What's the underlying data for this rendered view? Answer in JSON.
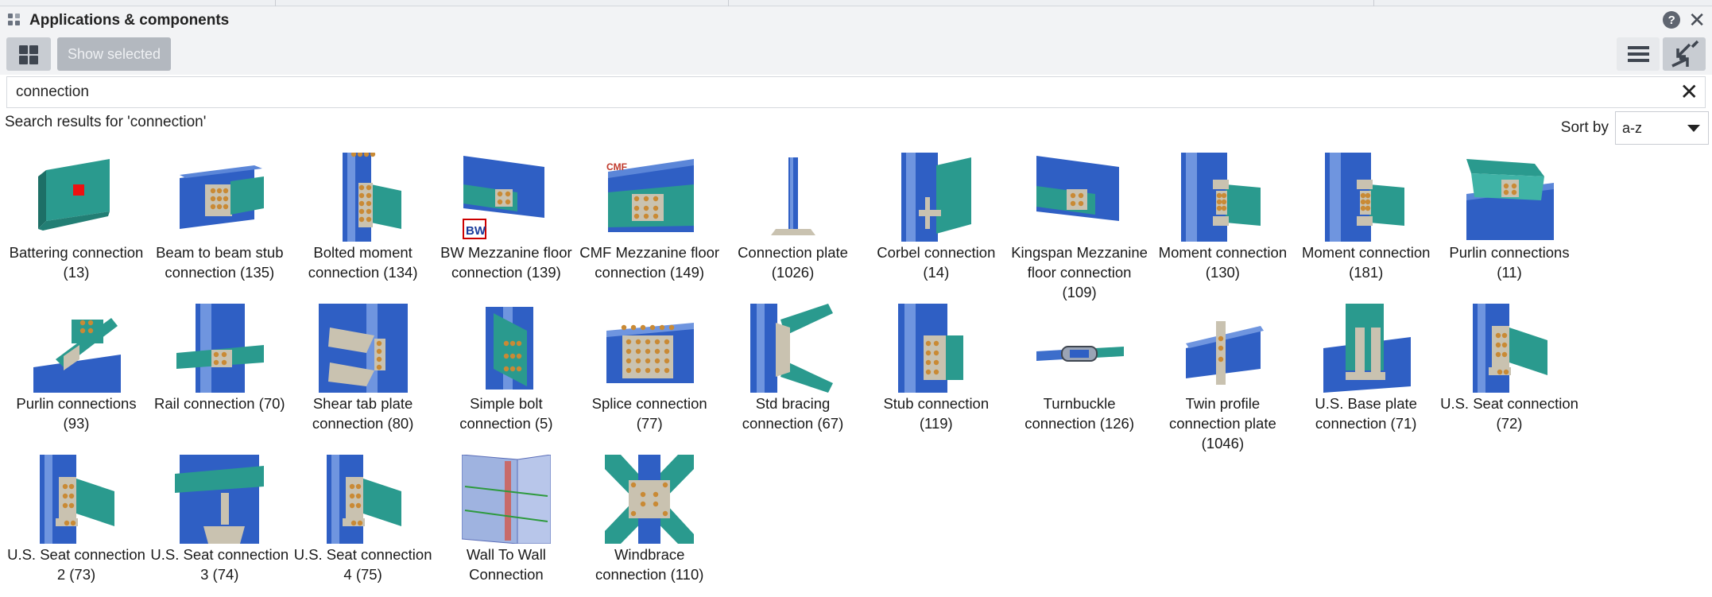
{
  "window": {
    "title": "Applications & components"
  },
  "toolbar": {
    "show_selected_label": "Show selected"
  },
  "search": {
    "value": "connection",
    "placeholder": ""
  },
  "results": {
    "heading": "Search results for 'connection'"
  },
  "sort": {
    "label": "Sort by",
    "selected": "a-z"
  },
  "colors": {
    "steel_blue": "#2f5fc4",
    "teal": "#2a9a8e",
    "plate": "#c9c2b0",
    "bolt": "#c98a35"
  },
  "components": [
    {
      "line1": "Battering connection",
      "line2": "(13)",
      "line3": "",
      "icon": "battering-icon"
    },
    {
      "line1": "Beam to beam stub",
      "line2": "connection (135)",
      "line3": "",
      "icon": "beam-stub-icon"
    },
    {
      "line1": "Bolted moment",
      "line2": "connection (134)",
      "line3": "",
      "icon": "bolted-moment-icon"
    },
    {
      "line1": "BW Mezzanine floor",
      "line2": "connection (139)",
      "line3": "",
      "icon": "bw-mezzanine-icon",
      "badge": "BW"
    },
    {
      "line1": "CMF Mezzanine floor",
      "line2": "connection (149)",
      "line3": "",
      "icon": "cmf-mezzanine-icon",
      "badge": "CMF"
    },
    {
      "line1": "Connection plate",
      "line2": "(1026)",
      "line3": "",
      "icon": "connection-plate-icon"
    },
    {
      "line1": "Corbel connection",
      "line2": "(14)",
      "line3": "",
      "icon": "corbel-icon"
    },
    {
      "line1": "Kingspan Mezzanine",
      "line2": "floor connection",
      "line3": "(109)",
      "icon": "kingspan-icon"
    },
    {
      "line1": "Moment connection",
      "line2": "(130)",
      "line3": "",
      "icon": "moment-icon"
    },
    {
      "line1": "Moment connection",
      "line2": "(181)",
      "line3": "",
      "icon": "moment-icon"
    },
    {
      "line1": "Purlin connections",
      "line2": "(11)",
      "line3": "",
      "icon": "purlin-icon"
    },
    {
      "line1": "Purlin connections",
      "line2": "(93)",
      "line3": "",
      "icon": "purlin-cleat-icon"
    },
    {
      "line1": "Rail connection (70)",
      "line2": "",
      "line3": "",
      "icon": "rail-icon"
    },
    {
      "line1": "Shear tab plate",
      "line2": "connection (80)",
      "line3": "",
      "icon": "shear-tab-icon"
    },
    {
      "line1": "Simple bolt",
      "line2": "connection (5)",
      "line3": "",
      "icon": "simple-bolt-icon"
    },
    {
      "line1": "Splice connection",
      "line2": "(77)",
      "line3": "",
      "icon": "splice-icon"
    },
    {
      "line1": "Std bracing",
      "line2": "connection (67)",
      "line3": "",
      "icon": "bracing-icon"
    },
    {
      "line1": "Stub connection",
      "line2": "(119)",
      "line3": "",
      "icon": "stub-icon"
    },
    {
      "line1": "Turnbuckle",
      "line2": "connection (126)",
      "line3": "",
      "icon": "turnbuckle-icon"
    },
    {
      "line1": "Twin profile",
      "line2": "connection plate",
      "line3": "(1046)",
      "icon": "twin-profile-icon"
    },
    {
      "line1": "U.S. Base plate",
      "line2": "connection (71)",
      "line3": "",
      "icon": "base-plate-icon"
    },
    {
      "line1": "U.S. Seat connection",
      "line2": "(72)",
      "line3": "",
      "icon": "seat-icon"
    },
    {
      "line1": "U.S. Seat connection",
      "line2": "2 (73)",
      "line3": "",
      "icon": "seat-icon"
    },
    {
      "line1": "U.S. Seat connection",
      "line2": "3 (74)",
      "line3": "",
      "icon": "seat-beam-icon"
    },
    {
      "line1": "U.S. Seat connection",
      "line2": "4 (75)",
      "line3": "",
      "icon": "seat-icon"
    },
    {
      "line1": "Wall To Wall",
      "line2": "Connection",
      "line3": "",
      "icon": "wall-to-wall-icon"
    },
    {
      "line1": "Windbrace",
      "line2": "connection (110)",
      "line3": "",
      "icon": "windbrace-icon"
    }
  ]
}
